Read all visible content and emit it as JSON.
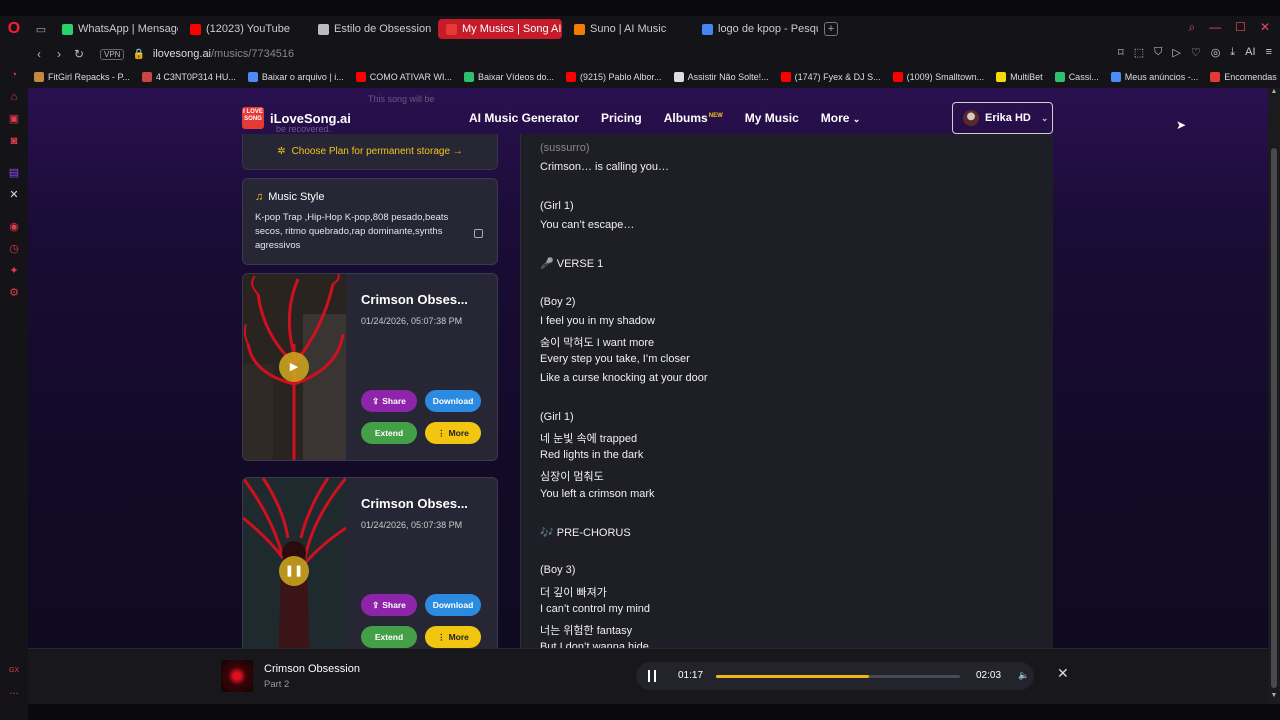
{
  "browser": {
    "tabs": [
      {
        "label": "WhatsApp | Mensagens e",
        "color": "#25d366"
      },
      {
        "label": "(12023) YouTube",
        "color": "#ff0000"
      },
      {
        "label": "Estilo de Obsession EXO",
        "color": "#bbbbbb"
      },
      {
        "label": "My Musics | Song AI",
        "color": "#e53935",
        "active": true
      },
      {
        "label": "Suno | AI Music",
        "color": "#f57c00"
      },
      {
        "label": "logo de kpop - Pesquisa G",
        "color": "#4285f4"
      }
    ],
    "new_tab": "+",
    "url_host": "ilovesong.ai",
    "url_path": "/musics/7734516",
    "vpn": "VPN",
    "ai_label": "AI",
    "bookmarks": [
      {
        "label": "FitGirl Repacks - P...",
        "color": "#c48a3c"
      },
      {
        "label": "4 C3NT0P314 HU...",
        "color": "#cc4444"
      },
      {
        "label": "Baixar o arquivo | i...",
        "color": "#4a8cf5"
      },
      {
        "label": "COMO ATIVAR WI...",
        "color": "#ff0000"
      },
      {
        "label": "Baixar Vídeos do...",
        "color": "#2fbf71"
      },
      {
        "label": "(9215) Pablo Albor...",
        "color": "#ff0000"
      },
      {
        "label": "Assistir Não Solte!...",
        "color": "#dddddd"
      },
      {
        "label": "(1747) Fyex & DJ S...",
        "color": "#ff0000"
      },
      {
        "label": "(1009) Smalltown...",
        "color": "#ff0000"
      },
      {
        "label": "MultiBet",
        "color": "#f5d90a"
      },
      {
        "label": "Cassi...",
        "color": "#2fbf71"
      },
      {
        "label": "Meus anúncios -...",
        "color": "#4a8cf5"
      },
      {
        "label": "Encomendas",
        "color": "#e53935"
      }
    ],
    "sidebar_gx": "GX",
    "sidebar_more": "..."
  },
  "site": {
    "logo_box": "I LOVE SONG",
    "logo_text": "iLoveSong.ai",
    "nav": [
      "AI Music Generator",
      "Pricing",
      "Albums",
      "My Music",
      "More"
    ],
    "albums_badge": "NEW",
    "user_name": "Erika HD",
    "ghost_line1": "This song will be",
    "ghost_line2": "be recovered."
  },
  "storage": {
    "label": "Choose Plan for permanent storage →"
  },
  "music_style": {
    "title": "Music Style",
    "body": "K-pop Trap ,Hip-Hop K-pop,808 pesado,beats secos, ritmo quebrado,rap dominante,synths agressivos"
  },
  "songs": [
    {
      "title": "Crimson Obses...",
      "date": "01/24/2026, 05:07:38 PM",
      "state": "play"
    },
    {
      "title": "Crimson Obses...",
      "date": "01/24/2026, 05:07:38 PM",
      "state": "pause"
    }
  ],
  "song_buttons": {
    "share": "Share",
    "download": "Download",
    "extend": "Extend",
    "more": "More"
  },
  "lyrics": [
    {
      "text": "(sussurro)",
      "dim": true
    },
    {
      "text": "Crimson… is calling you…"
    },
    {
      "text": ""
    },
    {
      "text": "(Girl 1)"
    },
    {
      "text": "You can’t escape…"
    },
    {
      "text": ""
    },
    {
      "text": "🎤 VERSE 1"
    },
    {
      "text": ""
    },
    {
      "text": "(Boy 2)"
    },
    {
      "text": "I feel you in my shadow"
    },
    {
      "text": "숨이 막혀도 I want more"
    },
    {
      "text": "Every step you take, I’m closer"
    },
    {
      "text": "Like a curse knocking at your door"
    },
    {
      "text": ""
    },
    {
      "text": "(Girl 1)"
    },
    {
      "text": "네 눈빛 속에 trapped"
    },
    {
      "text": "Red lights in the dark"
    },
    {
      "text": "심장이 멈춰도"
    },
    {
      "text": "You left a crimson mark"
    },
    {
      "text": ""
    },
    {
      "text": "🎶 PRE-CHORUS"
    },
    {
      "text": ""
    },
    {
      "text": "(Boy 3)"
    },
    {
      "text": "더 깊이 빠져가"
    },
    {
      "text": "I can’t control my mind"
    },
    {
      "text": "너는 위험한 fantasy"
    },
    {
      "text": "But I don’t wanna hide"
    }
  ],
  "player": {
    "title": "Crimson Obsession",
    "subtitle": "Part 2",
    "current": "01:17",
    "duration": "02:03",
    "progress": 0.626
  }
}
